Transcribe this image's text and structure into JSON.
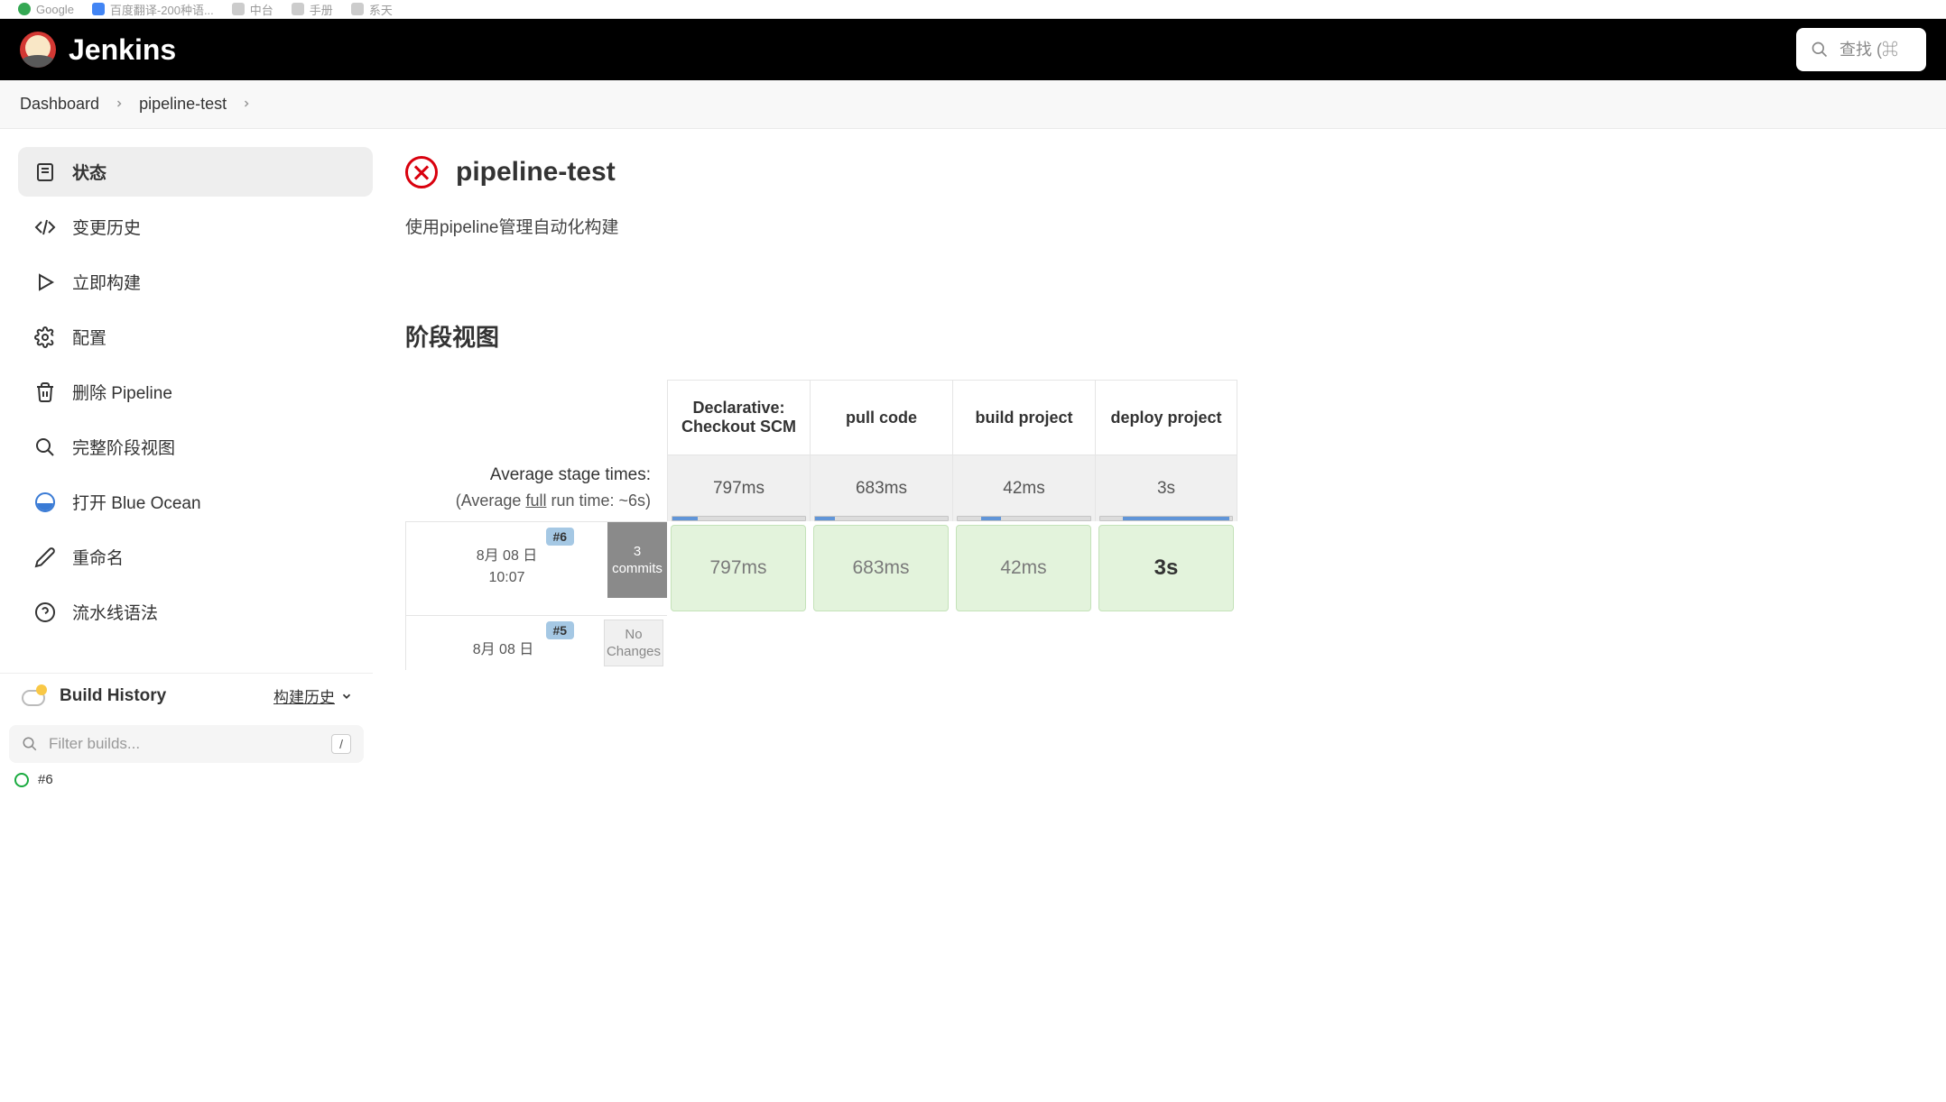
{
  "browser_bookmarks": [
    "Google",
    "百度翻译-200种语...",
    "中台",
    "手册",
    "系天"
  ],
  "header": {
    "brand": "Jenkins",
    "search_placeholder": "查找 (⌘"
  },
  "breadcrumb": [
    {
      "label": "Dashboard"
    },
    {
      "label": "pipeline-test"
    }
  ],
  "sidebar": {
    "items": [
      {
        "label": "状态",
        "icon": "status",
        "active": true
      },
      {
        "label": "变更历史",
        "icon": "changes"
      },
      {
        "label": "立即构建",
        "icon": "build-now"
      },
      {
        "label": "配置",
        "icon": "configure"
      },
      {
        "label": "删除 Pipeline",
        "icon": "delete"
      },
      {
        "label": "完整阶段视图",
        "icon": "full-stage"
      },
      {
        "label": "打开 Blue Ocean",
        "icon": "blue-ocean"
      },
      {
        "label": "重命名",
        "icon": "rename"
      },
      {
        "label": "流水线语法",
        "icon": "pipeline-syntax"
      }
    ],
    "build_history": {
      "title": "Build History",
      "link_label": "构建历史",
      "filter_placeholder": "Filter builds...",
      "filter_kbd": "/",
      "latest": "#6"
    }
  },
  "main": {
    "title": "pipeline-test",
    "description": "使用pipeline管理自动化构建",
    "section_title": "阶段视图",
    "stage_view": {
      "columns": [
        "Declarative: Checkout SCM",
        "pull code",
        "build project",
        "deploy project"
      ],
      "avg_label_line1": "Average stage times:",
      "avg_label_line2_pre": "(Average ",
      "avg_label_line2_u": "full",
      "avg_label_line2_post": " run time: ~6s)",
      "avg_times": [
        "797ms",
        "683ms",
        "42ms",
        "3s"
      ],
      "avg_bar_widths": [
        18,
        14,
        14,
        100
      ],
      "builds": [
        {
          "num": "#6",
          "date_line1": "8月 08 日",
          "date_line2": "10:07",
          "commits_line1": "3",
          "commits_line2": "commits",
          "commits_style": "dark",
          "times": [
            "797ms",
            "683ms",
            "42ms",
            "3s"
          ],
          "bold_last": true
        },
        {
          "num": "#5",
          "date_line1": "8月 08 日",
          "date_line2": "",
          "commits_line1": "No",
          "commits_line2": "Changes",
          "commits_style": "light",
          "times": [],
          "bold_last": false
        }
      ]
    }
  }
}
